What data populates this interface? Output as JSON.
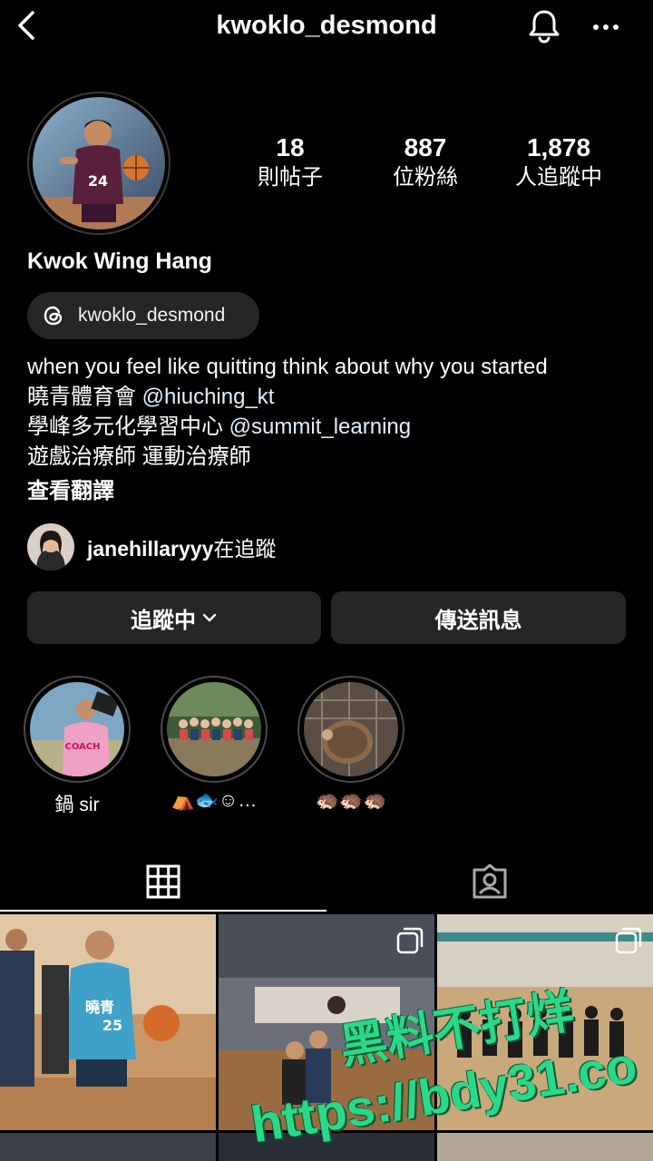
{
  "header": {
    "username": "kwoklo_desmond"
  },
  "profile": {
    "name": "Kwok Wing Hang",
    "stats": [
      {
        "value": "18",
        "label": "則帖子"
      },
      {
        "value": "887",
        "label": "位粉絲"
      },
      {
        "value": "1,878",
        "label": "人追蹤中"
      }
    ],
    "threads_handle": "kwoklo_desmond",
    "bio": {
      "line1": "when you feel like quitting think about why you started",
      "line2_prefix": "曉青體育會 ",
      "line2_link": "@hiuching_kt",
      "line3_prefix": "學峰多元化學習中心 ",
      "line3_link": "@summit_learning",
      "line4": "遊戲治療師 運動治療師",
      "translate": "查看翻譯"
    },
    "mutual": {
      "user": "janehillaryyy",
      "suffix": "在追蹤"
    }
  },
  "actions": {
    "following": "追蹤中",
    "message": "傳送訊息"
  },
  "highlights": [
    {
      "label": "鍋 sir"
    },
    {
      "label": "⛺🐟☺…"
    },
    {
      "label": "🦔🦔🦔"
    }
  ],
  "tabs": [
    {
      "icon": "grid-icon"
    },
    {
      "icon": "tagged-icon"
    }
  ],
  "watermark": {
    "line1": "黑料不打烊",
    "line2": "https://bdy31.co"
  },
  "colors": {
    "background": "#000000",
    "button": "#262626",
    "link": "#e0f1ff",
    "watermark": "#2bd88a"
  }
}
